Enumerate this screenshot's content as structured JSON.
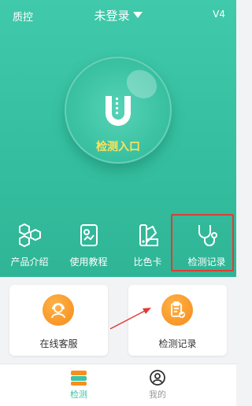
{
  "header": {
    "left_label": "质控",
    "title": "未登录",
    "version": "V4"
  },
  "hero": {
    "entry_label": "检测入口",
    "logo_icon": "u-shield-icon"
  },
  "menu": [
    {
      "label": "产品介绍",
      "icon": "hexagons-icon"
    },
    {
      "label": "使用教程",
      "icon": "tutorial-book-icon"
    },
    {
      "label": "比色卡",
      "icon": "color-swatch-icon"
    },
    {
      "label": "检测记录",
      "icon": "stethoscope-icon"
    }
  ],
  "cards": [
    {
      "label": "在线客服",
      "icon": "customer-service-icon"
    },
    {
      "label": "检测记录",
      "icon": "clipboard-check-icon"
    }
  ],
  "tabbar": [
    {
      "label": "检测",
      "icon": "detect-tab-icon",
      "active": true
    },
    {
      "label": "我的",
      "icon": "user-icon",
      "active": false
    }
  ],
  "colors": {
    "primary": "#3cc3a4",
    "accent_yellow": "#ffe35a",
    "highlight_red": "#e23a35",
    "card_orange": "#f5901e"
  }
}
